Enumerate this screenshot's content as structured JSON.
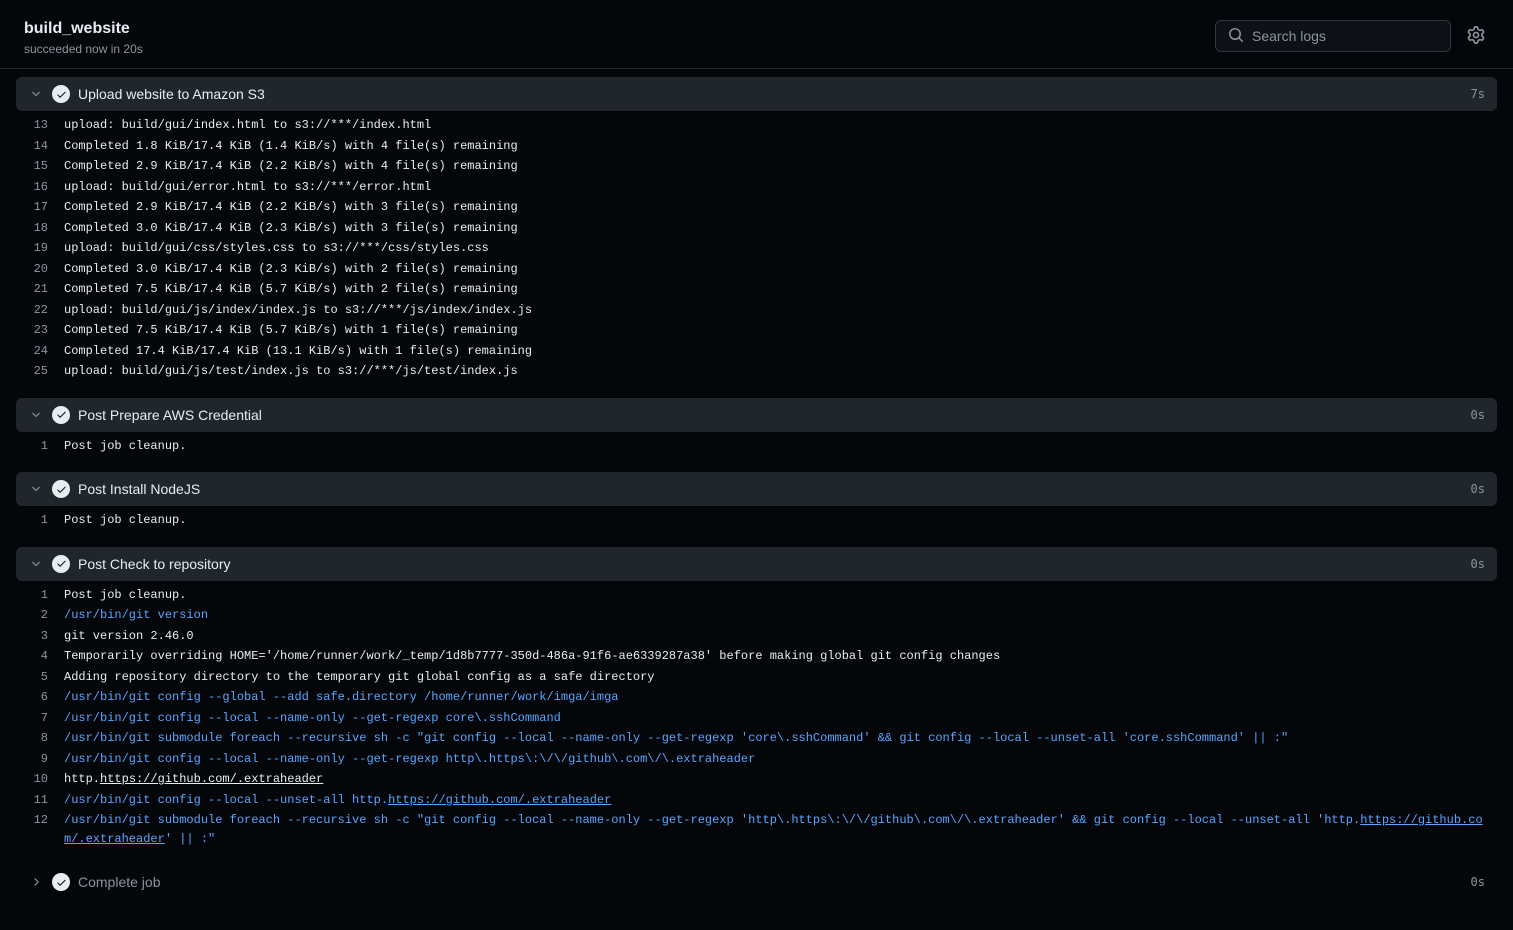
{
  "header": {
    "title": "build_website",
    "subtitle": "succeeded now in 20s",
    "search_placeholder": "Search logs"
  },
  "steps": [
    {
      "title": "Upload website to Amazon S3",
      "time": "7s",
      "expanded": true,
      "lines": [
        {
          "no": 13,
          "type": "plain",
          "text": "upload: build/gui/index.html to s3://***/index.html"
        },
        {
          "no": 14,
          "type": "plain",
          "text": "Completed 1.8 KiB/17.4 KiB (1.4 KiB/s) with 4 file(s) remaining"
        },
        {
          "no": 15,
          "type": "plain",
          "text": "Completed 2.9 KiB/17.4 KiB (2.2 KiB/s) with 4 file(s) remaining"
        },
        {
          "no": 16,
          "type": "plain",
          "text": "upload: build/gui/error.html to s3://***/error.html"
        },
        {
          "no": 17,
          "type": "plain",
          "text": "Completed 2.9 KiB/17.4 KiB (2.2 KiB/s) with 3 file(s) remaining"
        },
        {
          "no": 18,
          "type": "plain",
          "text": "Completed 3.0 KiB/17.4 KiB (2.3 KiB/s) with 3 file(s) remaining"
        },
        {
          "no": 19,
          "type": "plain",
          "text": "upload: build/gui/css/styles.css to s3://***/css/styles.css"
        },
        {
          "no": 20,
          "type": "plain",
          "text": "Completed 3.0 KiB/17.4 KiB (2.3 KiB/s) with 2 file(s) remaining"
        },
        {
          "no": 21,
          "type": "plain",
          "text": "Completed 7.5 KiB/17.4 KiB (5.7 KiB/s) with 2 file(s) remaining"
        },
        {
          "no": 22,
          "type": "plain",
          "text": "upload: build/gui/js/index/index.js to s3://***/js/index/index.js"
        },
        {
          "no": 23,
          "type": "plain",
          "text": "Completed 7.5 KiB/17.4 KiB (5.7 KiB/s) with 1 file(s) remaining"
        },
        {
          "no": 24,
          "type": "plain",
          "text": "Completed 17.4 KiB/17.4 KiB (13.1 KiB/s) with 1 file(s) remaining"
        },
        {
          "no": 25,
          "type": "plain",
          "text": "upload: build/gui/js/test/index.js to s3://***/js/test/index.js"
        }
      ]
    },
    {
      "title": "Post Prepare AWS Credential",
      "time": "0s",
      "expanded": true,
      "lines": [
        {
          "no": 1,
          "type": "plain",
          "text": "Post job cleanup."
        }
      ]
    },
    {
      "title": "Post Install NodeJS",
      "time": "0s",
      "expanded": true,
      "lines": [
        {
          "no": 1,
          "type": "plain",
          "text": "Post job cleanup."
        }
      ]
    },
    {
      "title": "Post Check to repository",
      "time": "0s",
      "expanded": true,
      "lines": [
        {
          "no": 1,
          "type": "plain",
          "text": "Post job cleanup."
        },
        {
          "no": 2,
          "type": "cmd",
          "text": "/usr/bin/git version"
        },
        {
          "no": 3,
          "type": "plain",
          "text": "git version 2.46.0"
        },
        {
          "no": 4,
          "type": "plain",
          "text": "Temporarily overriding HOME='/home/runner/work/_temp/1d8b7777-350d-486a-91f6-ae6339287a38' before making global git config changes"
        },
        {
          "no": 5,
          "type": "plain",
          "text": "Adding repository directory to the temporary git global config as a safe directory"
        },
        {
          "no": 6,
          "type": "cmd",
          "text": "/usr/bin/git config --global --add safe.directory /home/runner/work/imga/imga"
        },
        {
          "no": 7,
          "type": "cmd",
          "text": "/usr/bin/git config --local --name-only --get-regexp core\\.sshCommand"
        },
        {
          "no": 8,
          "type": "cmd",
          "text": "/usr/bin/git submodule foreach --recursive sh -c \"git config --local --name-only --get-regexp 'core\\.sshCommand' && git config --local --unset-all 'core.sshCommand' || :\""
        },
        {
          "no": 9,
          "type": "cmd",
          "text": "/usr/bin/git config --local --name-only --get-regexp http\\.https\\:\\/\\/github\\.com\\/\\.extraheader"
        },
        {
          "no": 10,
          "type": "plain",
          "segments": [
            {
              "t": "http."
            },
            {
              "t": "https://github.com/.extraheader",
              "link": true
            }
          ]
        },
        {
          "no": 11,
          "type": "cmd",
          "segments": [
            {
              "t": "/usr/bin/git config --local --unset-all http."
            },
            {
              "t": "https://github.com/.extraheader",
              "link": true
            }
          ]
        },
        {
          "no": 12,
          "type": "cmd",
          "segments": [
            {
              "t": "/usr/bin/git submodule foreach --recursive sh -c \"git config --local --name-only --get-regexp 'http\\.https\\:\\/\\/github\\.com\\/\\.extraheader' && git config --local --unset-all 'http."
            },
            {
              "t": "https://github.com/.extraheader",
              "link": true
            },
            {
              "t": "' || :\""
            }
          ]
        }
      ]
    },
    {
      "title": "Complete job",
      "time": "0s",
      "expanded": false,
      "lines": []
    }
  ]
}
